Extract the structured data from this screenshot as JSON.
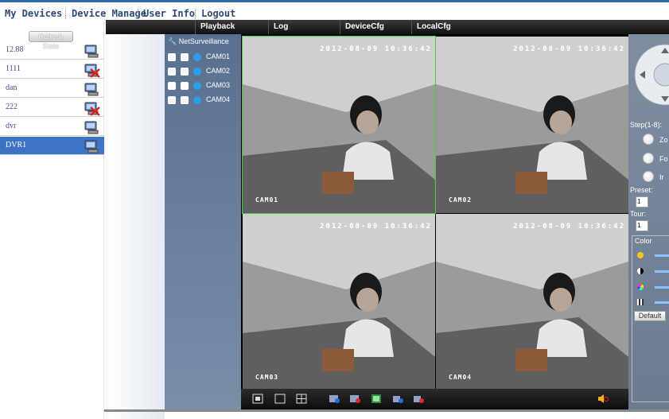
{
  "topnav": {
    "items": [
      "My Devices",
      "Device Manage",
      "User Info",
      "Logout"
    ]
  },
  "tabbar": {
    "tabs": [
      "Playback",
      "Log",
      "DeviceCfg",
      "LocalCfg"
    ]
  },
  "devices": {
    "refresh_label": "Refresh State",
    "items": [
      {
        "name": "12.88",
        "status_icon": "pc-online-icon"
      },
      {
        "name": "1111",
        "status_icon": "pc-offline-icon"
      },
      {
        "name": "dan",
        "status_icon": "pc-online-icon"
      },
      {
        "name": "222",
        "status_icon": "pc-offline-icon"
      },
      {
        "name": "dvr",
        "status_icon": "pc-online-icon"
      },
      {
        "name": "DVR1",
        "status_icon": "pc-online-icon",
        "selected": true
      }
    ]
  },
  "tree": {
    "root_label": "NetSurveillance",
    "cameras": [
      "CAM01",
      "CAM02",
      "CAM03",
      "CAM04"
    ]
  },
  "video": {
    "timestamp": "2012-08-09 10:36:42",
    "tiles": [
      {
        "label": "CAM01",
        "active": true
      },
      {
        "label": "CAM02",
        "active": false
      },
      {
        "label": "CAM03",
        "active": false
      },
      {
        "label": "CAM04",
        "active": false
      }
    ],
    "toolbar_icons": [
      "fullscreen-icon",
      "single-view-icon",
      "quad-view-icon",
      "record-icon",
      "stop-record-icon",
      "snapshot-icon",
      "talk-icon",
      "stop-talk-icon",
      "mute-icon"
    ]
  },
  "ptz": {
    "step_label": "Step(1-8):",
    "zoom_label": "Zo",
    "focus_label": "Fo",
    "iris_label": "Ir",
    "preset_label": "Preset:",
    "preset_value": "1",
    "tour_label": "Tour:",
    "tour_value": "1",
    "color_label": "Color",
    "default_label": "Default",
    "colors": {
      "accent": "#3d74c6",
      "active_border": "#3fd13f"
    }
  }
}
